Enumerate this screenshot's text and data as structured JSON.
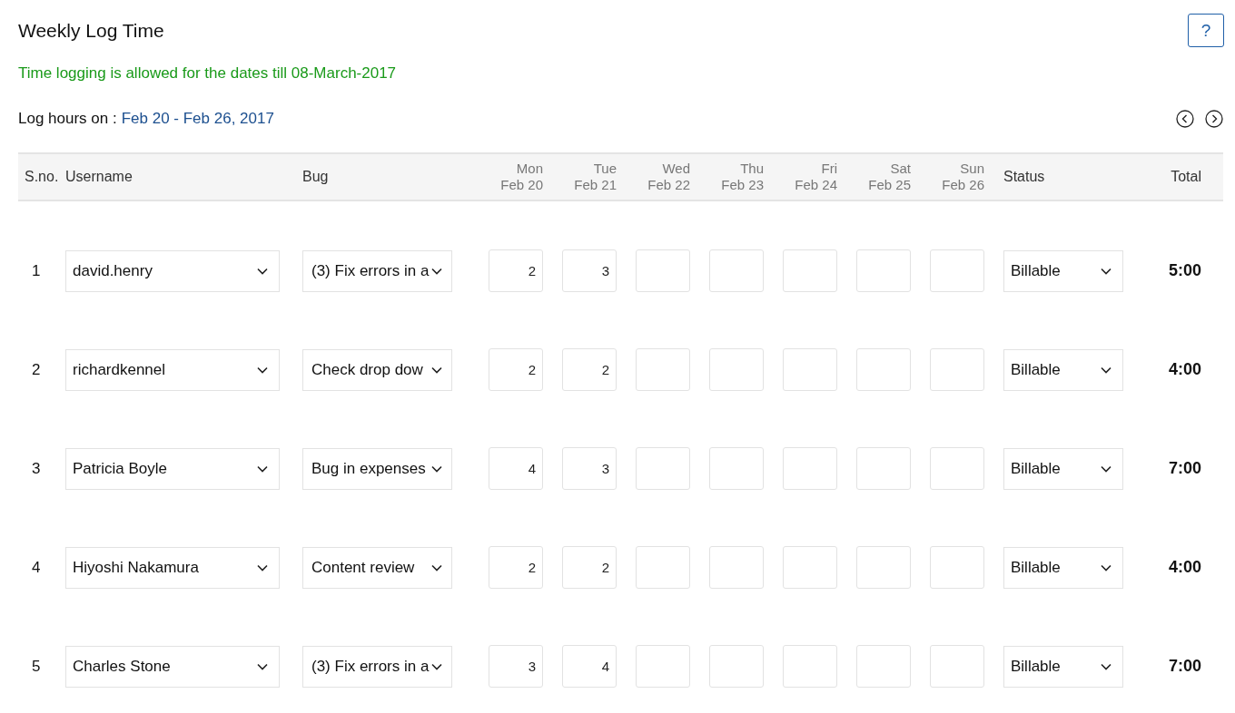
{
  "title": "Weekly Log Time",
  "help_button": {
    "label": "?"
  },
  "notice": "Time logging is allowed for the dates till 08-March-2017",
  "log_hours": {
    "label": "Log hours on :",
    "range": "Feb 20 - Feb 26, 2017"
  },
  "table": {
    "columns": [
      "S.no.",
      "Username",
      "Bug"
    ],
    "days": [
      {
        "day": "Mon",
        "date": "Feb 20"
      },
      {
        "day": "Tue",
        "date": "Feb 21"
      },
      {
        "day": "Wed",
        "date": "Feb 22"
      },
      {
        "day": "Thu",
        "date": "Feb 23"
      },
      {
        "day": "Fri",
        "date": "Feb 24"
      },
      {
        "day": "Sat",
        "date": "Feb 25"
      },
      {
        "day": "Sun",
        "date": "Feb 26"
      }
    ],
    "status_column": "Status",
    "total_column": "Total",
    "rows": [
      {
        "sno": "1",
        "username": "david.henry",
        "bug": "(3) Fix errors in a",
        "hours": [
          "2",
          "3"
        ],
        "status": "Billable",
        "total": "5:00"
      },
      {
        "sno": "2",
        "username": "richardkennel",
        "bug": "Check drop dow",
        "hours": [
          "2",
          "2"
        ],
        "status": "Billable",
        "total": "4:00"
      },
      {
        "sno": "3",
        "username": "Patricia Boyle",
        "bug": "Bug in expenses",
        "hours": [
          "4",
          "3"
        ],
        "status": "Billable",
        "total": "7:00"
      },
      {
        "sno": "4",
        "username": "Hiyoshi Nakamura",
        "bug": "Content review",
        "hours": [
          "2",
          "2"
        ],
        "status": "Billable",
        "total": "4:00"
      },
      {
        "sno": "5",
        "username": "Charles Stone",
        "bug": "(3) Fix errors in a",
        "hours": [
          "3",
          "4"
        ],
        "status": "Billable",
        "total": "7:00"
      }
    ]
  }
}
